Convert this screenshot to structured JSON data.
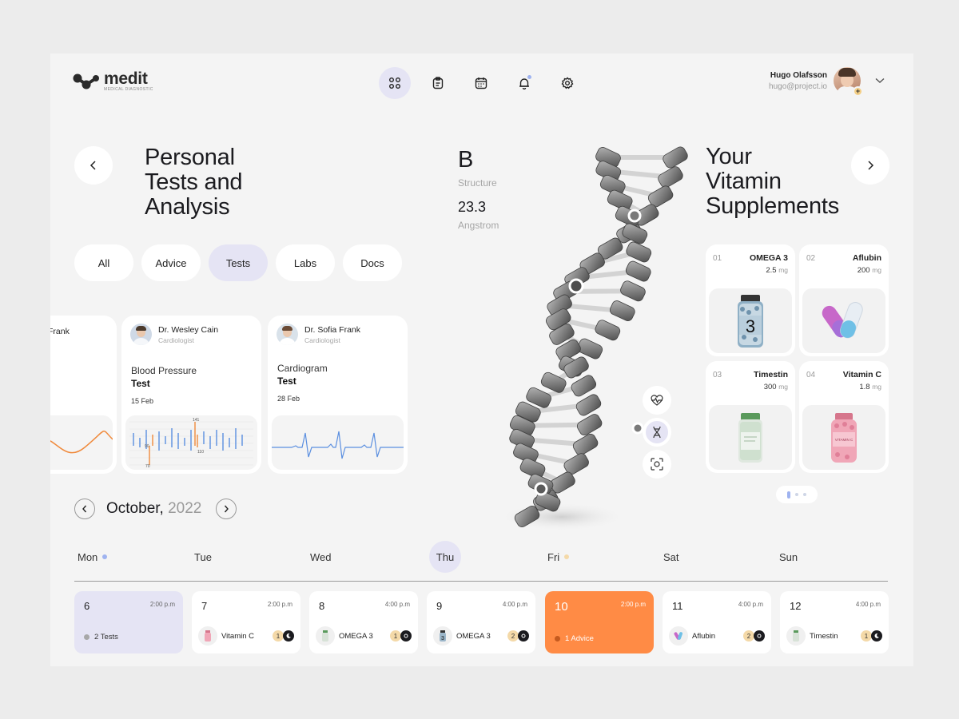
{
  "brand": {
    "name": "medit",
    "tagline": "MEDICAL DIAGNOSTIC"
  },
  "nav": [
    {
      "icon": "dashboard-icon",
      "active": true
    },
    {
      "icon": "clipboard-icon",
      "active": false
    },
    {
      "icon": "calendar-icon",
      "active": false
    },
    {
      "icon": "bell-icon",
      "active": false,
      "badge": true
    },
    {
      "icon": "gear-icon",
      "active": false
    }
  ],
  "user": {
    "name": "Hugo Olafsson",
    "email": "hugo@project.io",
    "badge": "+"
  },
  "tests": {
    "title_lines": [
      "Personal",
      "Tests and",
      "Analysis"
    ],
    "filters": [
      "All",
      "Advice",
      "Tests",
      "Labs",
      "Docs"
    ],
    "selected_filter": "Tests",
    "cards": [
      {
        "doctor": "Frank",
        "role": "",
        "title": "",
        "subtitle": "",
        "date": ""
      },
      {
        "doctor": "Dr. Wesley Cain",
        "role": "Cardiologist",
        "title": "Blood Pressure",
        "subtitle": "Test",
        "date": "15 Feb",
        "labels": {
          "top": "141",
          "left": "90",
          "mid": "110",
          "bottom": "70"
        }
      },
      {
        "doctor": "Dr. Sofia Frank",
        "role": "Cardiologist",
        "title": "Cardiogram",
        "subtitle": "Test",
        "date": "28 Feb"
      }
    ]
  },
  "structure": {
    "letter": "B",
    "label": "Structure",
    "value": "23.3",
    "unit": "Angstrom"
  },
  "vitamins": {
    "title_lines": [
      "Your",
      "Vitamin",
      "Supplements"
    ],
    "items": [
      {
        "num": "01",
        "name": "OMEGA 3",
        "dose": "2.5",
        "unit": "mg"
      },
      {
        "num": "02",
        "name": "Aflubin",
        "dose": "200",
        "unit": "mg"
      },
      {
        "num": "03",
        "name": "Timestin",
        "dose": "300",
        "unit": "mg"
      },
      {
        "num": "04",
        "name": "Vitamin C",
        "dose": "1.8",
        "unit": "mg"
      }
    ],
    "bottle_label_omega": "3",
    "bottle_label_vitc": "VITAMIN C"
  },
  "calendar": {
    "month": "October,",
    "year": "2022",
    "days": [
      "Mon",
      "Tue",
      "Wed",
      "Thu",
      "Fri",
      "Sat",
      "Sun"
    ],
    "entries": [
      {
        "day": "6",
        "time": "2:00 p.m",
        "label": "2 Tests"
      },
      {
        "day": "7",
        "time": "2:00 p.m",
        "item": "Vitamin C",
        "count": "1"
      },
      {
        "day": "8",
        "time": "4:00 p.m",
        "item": "OMEGA 3",
        "count": "1"
      },
      {
        "day": "9",
        "time": "4:00 p.m",
        "item": "OMEGA 3",
        "count": "2"
      },
      {
        "day": "10",
        "time": "2:00 p.m",
        "label": "1 Advice"
      },
      {
        "day": "11",
        "time": "4:00 p.m",
        "item": "Aflubin",
        "count": "2"
      },
      {
        "day": "12",
        "time": "4:00 p.m",
        "item": "Timestin",
        "count": "1"
      }
    ]
  },
  "colors": {
    "accent_lavender": "#e5e4f4",
    "accent_orange": "#ff8b45",
    "chart_blue": "#5b8fe0",
    "chart_orange": "#f08a3c"
  }
}
